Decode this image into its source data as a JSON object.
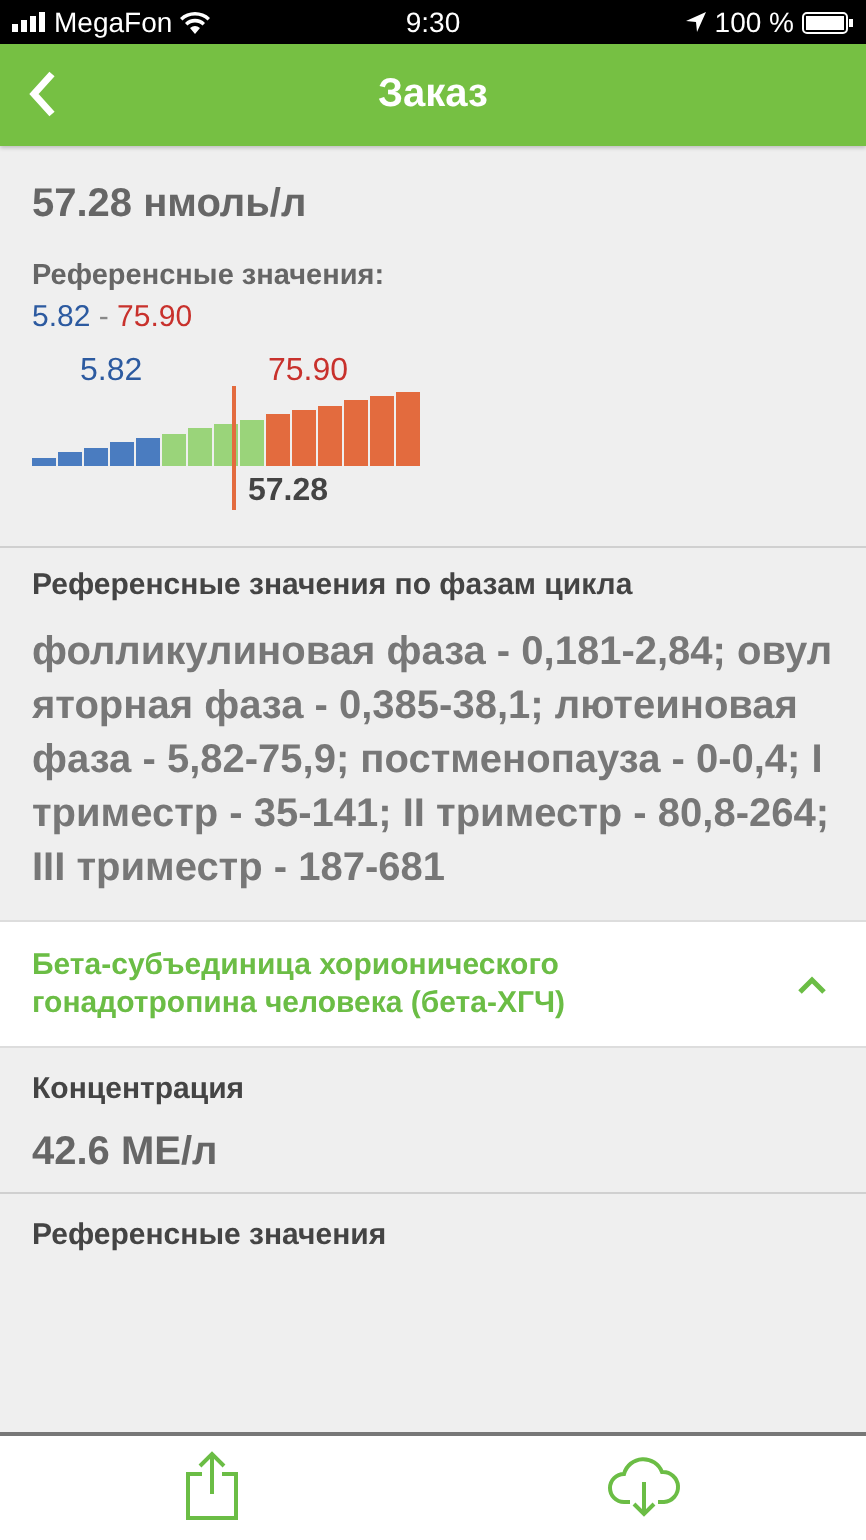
{
  "status_bar": {
    "carrier": "MegaFon",
    "time": "9:30",
    "battery": "100 %"
  },
  "nav": {
    "title": "Заказ"
  },
  "result": {
    "value": "57.28 нмоль/л",
    "reference_label": "Референсные значения:",
    "ref_low": "5.82",
    "ref_separator": "-",
    "ref_high": "75.90",
    "gauge": {
      "low_label": "5.82",
      "high_label": "75.90",
      "marker_label": "57.28"
    }
  },
  "phases": {
    "heading": "Референсные значения по фазам цикла",
    "text": "фолликулиновая фаза - 0,181-2,84; овуляторная фаза - 0,385-38,1; лютеиновая фаза - 5,82-75,9; постменопауза - 0-0,4; I триместр - 35-141; II триместр - 80,8-264; III триместр - 187-681"
  },
  "section": {
    "title": "Бета-субъединица хорионического гонадотропина человека (бета-ХГЧ)",
    "expanded": true
  },
  "fields": [
    {
      "label": "Концентрация",
      "value": "42.6 МЕ/л"
    },
    {
      "label": "Референсные значения"
    }
  ]
}
